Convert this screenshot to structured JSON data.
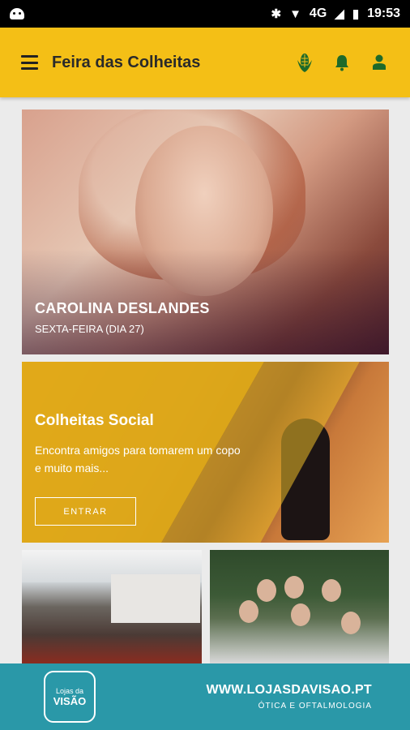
{
  "status_bar": {
    "time": "19:53",
    "network": "4G"
  },
  "app": {
    "title": "Feira das Colheitas"
  },
  "cards": [
    {
      "title": "CAROLINA DESLANDES",
      "subtitle": "SEXTA-FEIRA (DIA 27)"
    },
    {
      "title": "Colheitas Social",
      "description": "Encontra amigos para tomarem um copo e muito mais...",
      "button": "ENTRAR"
    }
  ],
  "banner": {
    "logo_small": "Lojas da",
    "logo_big": "VISÃO",
    "url": "WWW.LOJASDAVISAO.PT",
    "tagline": "ÓTICA E OFTALMOLOGIA"
  },
  "colors": {
    "appbar": "#f4bf16",
    "banner": "#2a98a8",
    "icons": "#1e6a2a"
  }
}
